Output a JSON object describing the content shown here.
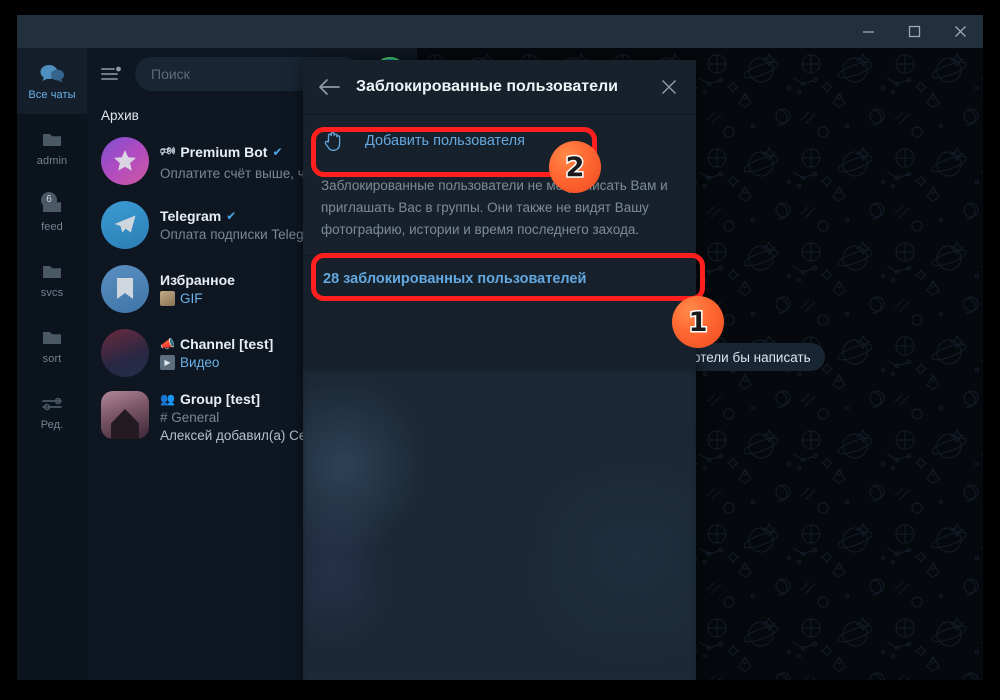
{
  "window": {
    "controls": [
      {
        "name": "minimize",
        "glyph": "minimize-icon"
      },
      {
        "name": "maximize",
        "glyph": "maximize-icon"
      },
      {
        "name": "close",
        "glyph": "close-icon"
      }
    ]
  },
  "sidebar": {
    "items": [
      {
        "label": "Все чаты",
        "icon": "chats-icon",
        "active": true,
        "badge": ""
      },
      {
        "label": "admin",
        "icon": "folder-icon",
        "active": false,
        "badge": ""
      },
      {
        "label": "feed",
        "icon": "folder-icon",
        "active": false,
        "badge": "6"
      },
      {
        "label": "svcs",
        "icon": "folder-icon",
        "active": false,
        "badge": ""
      },
      {
        "label": "sort",
        "icon": "folder-icon",
        "active": false,
        "badge": ""
      },
      {
        "label": "Ред.",
        "icon": "sliders-icon",
        "active": false,
        "badge": ""
      }
    ]
  },
  "search": {
    "placeholder": "Поиск",
    "menu_icon": "hamburger-icon",
    "avatar_icon": "telegram-avatar-with-story-ring"
  },
  "chat_list": {
    "section_title": "Архив",
    "rows": [
      {
        "avatar": "premium-star-avatar",
        "name": "Premium Bot",
        "name_prefix_icon": "megaphone-icon",
        "verified": true,
        "preview": "Оплатите счёт выше, чт",
        "preview_icon": "",
        "preview_blue": ""
      },
      {
        "avatar": "telegram-avatar",
        "name": "Telegram",
        "name_prefix_icon": "",
        "verified": true,
        "preview": "Оплата подписки Telegr",
        "preview_icon": "",
        "preview_blue": ""
      },
      {
        "avatar": "saved-messages-avatar",
        "name": "Избранное",
        "name_prefix_icon": "",
        "verified": false,
        "preview": "",
        "preview_icon": "gif-thumbnail",
        "preview_blue": "GIF"
      },
      {
        "avatar": "channel-photo-avatar",
        "name": "Channel [test]",
        "name_prefix_icon": "loudspeaker-icon",
        "verified": false,
        "preview": "",
        "preview_icon": "video-thumbnail",
        "preview_blue": "Видео"
      },
      {
        "avatar": "group-photo-avatar",
        "name": "Group [test]",
        "name_prefix_icon": "group-icon",
        "verified": false,
        "preview": "# General",
        "preview_line3": "Алексей добавил(а) Сем",
        "preview_icon": "",
        "preview_blue": ""
      }
    ]
  },
  "chat_area": {
    "bubble_text": "отели бы написать",
    "background": "star-wars-doodle-pattern"
  },
  "dialog": {
    "back_icon": "back-arrow-icon",
    "title": "Заблокированные пользователи",
    "close_icon": "close-icon",
    "add_user": {
      "icon": "stop-hand-icon",
      "label": "Добавить пользователя"
    },
    "description": "Заблокированные пользователи не могут писать Вам и приглашать Вас в группы. Они также не видят Вашу фотографию, истории и время последнего захода.",
    "blocked_count_label": "28 заблокированных пользователей"
  },
  "annotations": {
    "colors": {
      "outline": "#ff1f1f",
      "badge": "#ff6a33"
    },
    "badges": [
      {
        "number": "1",
        "target": "blocked-count-row"
      },
      {
        "number": "2",
        "target": "add-user-row"
      }
    ]
  }
}
